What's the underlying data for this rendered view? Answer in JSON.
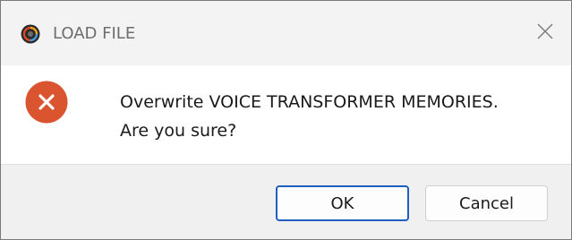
{
  "window": {
    "title": "LOAD FILE",
    "app_icon": "app-logo-icon",
    "close_icon": "close-icon"
  },
  "dialog": {
    "icon": "error-x-icon",
    "message_line1": "Overwrite VOICE TRANSFORMER MEMORIES.",
    "message_line2": "Are you sure?"
  },
  "buttons": {
    "ok_label": "OK",
    "cancel_label": "Cancel",
    "default": "OK"
  },
  "colors": {
    "error_icon": "#d9542f",
    "default_button_border": "#1f5fbf",
    "titlebar": "#f3f3f3",
    "button_bar": "#f0f0f0"
  }
}
